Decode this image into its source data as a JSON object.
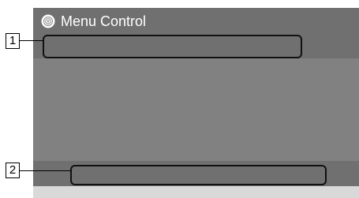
{
  "header": {
    "title": "Menu Control",
    "icon": "disc-icon"
  },
  "callouts": {
    "one": "1",
    "two": "2"
  },
  "colors": {
    "screen_bg": "#818181",
    "bar_bg": "#707070",
    "footer_bg": "#d9d9d9",
    "outline": "#111111",
    "title_text": "#ffffff"
  }
}
